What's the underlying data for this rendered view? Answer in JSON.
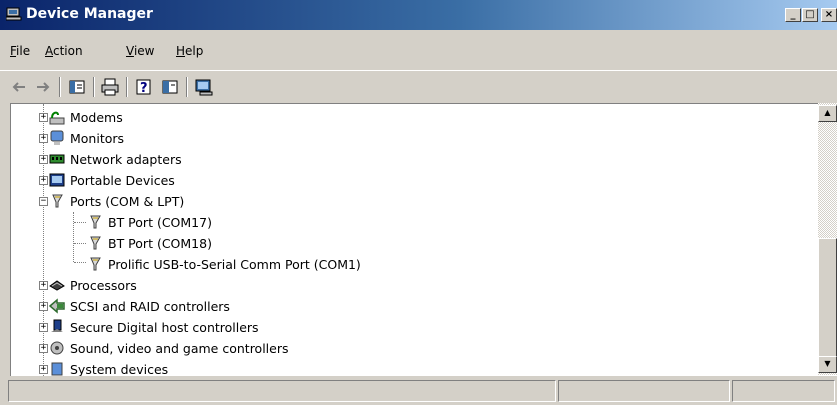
{
  "window": {
    "title": "Device Manager",
    "controls": {
      "minimize": "_",
      "maximize": "□",
      "close": "×"
    }
  },
  "menu": [
    {
      "label": "File",
      "accel": "F",
      "rest": "ile"
    },
    {
      "label": "Action",
      "accel": "A",
      "rest": "ction"
    },
    {
      "label": "View",
      "accel": "V",
      "rest": "iew"
    },
    {
      "label": "Help",
      "accel": "H",
      "rest": "elp"
    }
  ],
  "toolbar": [
    "back-arrow-icon",
    "forward-arrow-icon",
    "properties-icon",
    "print-icon",
    "help-icon",
    "console-tree-icon",
    "scan-hardware-icon"
  ],
  "tree": [
    {
      "label": "Modems",
      "icon": "modem-icon",
      "expander": "+"
    },
    {
      "label": "Monitors",
      "icon": "monitor-icon",
      "expander": "+"
    },
    {
      "label": "Network adapters",
      "icon": "network-adapter-icon",
      "expander": "+"
    },
    {
      "label": "Portable Devices",
      "icon": "portable-device-icon",
      "expander": "+"
    },
    {
      "label": "Ports (COM & LPT)",
      "icon": "port-icon",
      "expander": "−"
    },
    {
      "label": "BT Port (COM17)",
      "icon": "port-icon",
      "child": true
    },
    {
      "label": "BT Port (COM18)",
      "icon": "port-icon",
      "child": true
    },
    {
      "label": "Prolific USB-to-Serial Comm Port (COM1)",
      "icon": "port-icon",
      "child": true
    },
    {
      "label": "Processors",
      "icon": "processor-icon",
      "expander": "+"
    },
    {
      "label": "SCSI and RAID controllers",
      "icon": "scsi-icon",
      "expander": "+"
    },
    {
      "label": "Secure Digital host controllers",
      "icon": "sd-host-icon",
      "expander": "+"
    },
    {
      "label": "Sound, video and game controllers",
      "icon": "sound-icon",
      "expander": "+"
    },
    {
      "label": "System devices",
      "icon": "system-device-icon",
      "expander": "+"
    }
  ],
  "colors": {
    "titlebar": "#0a246a",
    "face": "#d4d0c8",
    "tree_bg": "#ffffff"
  }
}
